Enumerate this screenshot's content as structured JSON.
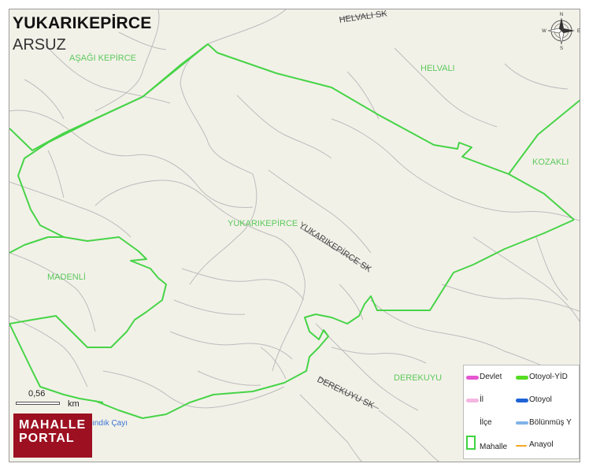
{
  "map": {
    "title": "YUKARIKEPİRCE",
    "subtitle": "ARSUZ",
    "colors": {
      "background": "#f2f1e8",
      "boundary": "#47d447",
      "road": "#b9b9b9",
      "place_label": "#5cc95c",
      "water_label": "#3b73d6",
      "logo": "#9c1021"
    }
  },
  "places": {
    "asagi_kepirce": "AŞAĞI KEPİRCE",
    "helvali": "HELVALI",
    "kozakli": "KOZAKLI",
    "yukarikepirce": "YUKARIKEPİRCE",
    "madenli": "MADENLİ",
    "derekuyu": "DEREKUYU"
  },
  "roads": {
    "helvali_sk": "HELVALI SK",
    "yukarikepirce_sk": "YUKARIKEPİRCE SK",
    "derekuyu_sk": "DEREKUYU SK"
  },
  "water": {
    "label": "ındık Çayı"
  },
  "compass": {
    "n": "N",
    "s": "S",
    "e": "E",
    "w": "W",
    "icon": "compass-rose-icon"
  },
  "scale": {
    "value": "0,56",
    "unit": "km"
  },
  "logo": {
    "line1": "MAHALLE",
    "line2": "PORTAL"
  },
  "legend": {
    "items": [
      {
        "label": "Devlet",
        "color": "#e455d0"
      },
      {
        "label": "Otoyol-YİD",
        "color": "#55dd22"
      },
      {
        "label": "İl",
        "color": "#f5b7e0"
      },
      {
        "label": "Otoyol",
        "color": "#1f63d6"
      },
      {
        "label": "İlçe",
        "color": ""
      },
      {
        "label": "Bölünmüş Y",
        "color": "#7fb3e8"
      },
      {
        "label": "Mahalle",
        "color": "#3fd33f"
      },
      {
        "label": "Anayol",
        "color": "#f5a623"
      }
    ]
  }
}
